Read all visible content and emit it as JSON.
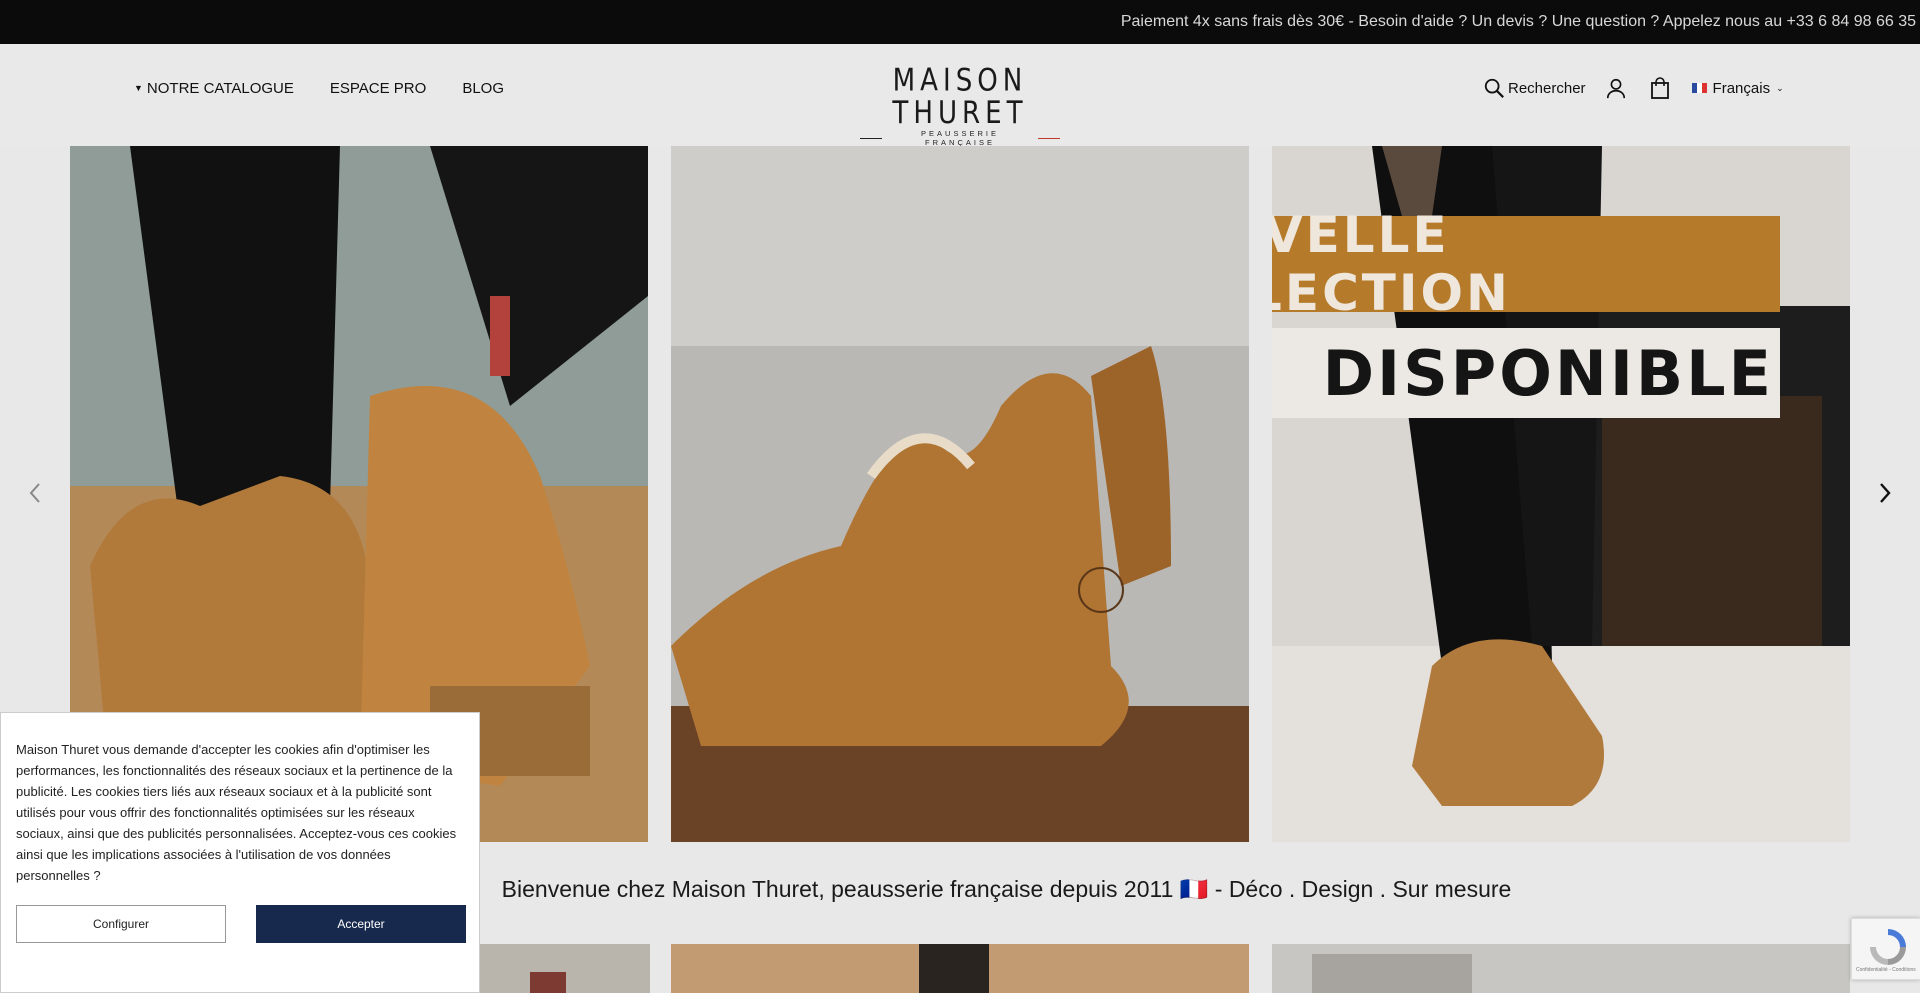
{
  "topbar": {
    "message": "Paiement 4x sans frais dès 30€ - Besoin d'aide ? Un devis ? Une question ? Appelez nous au +33 6 84 98 66 35"
  },
  "header": {
    "nav_left": [
      "NOTRE CATALOGUE",
      "ESPACE PRO",
      "BLOG"
    ],
    "logo": {
      "main": "MAISON THURET",
      "sub": "PEAUSSERIE FRANÇAISE"
    },
    "search_label": "Rechercher",
    "language": "Français"
  },
  "carousel": {
    "banner_line1": "NOUVELLE COLLECTION",
    "banner_line2": "DISPONIBLE"
  },
  "welcome": {
    "text": "Bienvenue chez Maison Thuret, peausserie française depuis 2011 🇫🇷 - Déco . Design . Sur mesure"
  },
  "cookie": {
    "text": "Maison Thuret vous demande d'accepter les cookies afin d'optimiser les performances, les fonctionnalités des réseaux sociaux et la pertinence de la publicité. Les cookies tiers liés aux réseaux sociaux et à la publicité sont utilisés pour vous offrir des fonctionnalités optimisées sur les réseaux sociaux, ainsi que des publicités personnalisées. Acceptez-vous ces cookies ainsi que les implications associées à l'utilisation de vos données personnelles ?",
    "configure_label": "Configurer",
    "accept_label": "Accepter"
  },
  "recaptcha": {
    "text": "Confidentialité - Conditions"
  },
  "colors": {
    "topbar_bg": "#0b0b0b",
    "accent_banner": "#b57b2b",
    "accept_button": "#172a4e"
  },
  "icons": [
    "search-icon",
    "account-icon",
    "cart-icon",
    "flag-fr-icon",
    "chevron-left-icon",
    "chevron-right-icon"
  ]
}
